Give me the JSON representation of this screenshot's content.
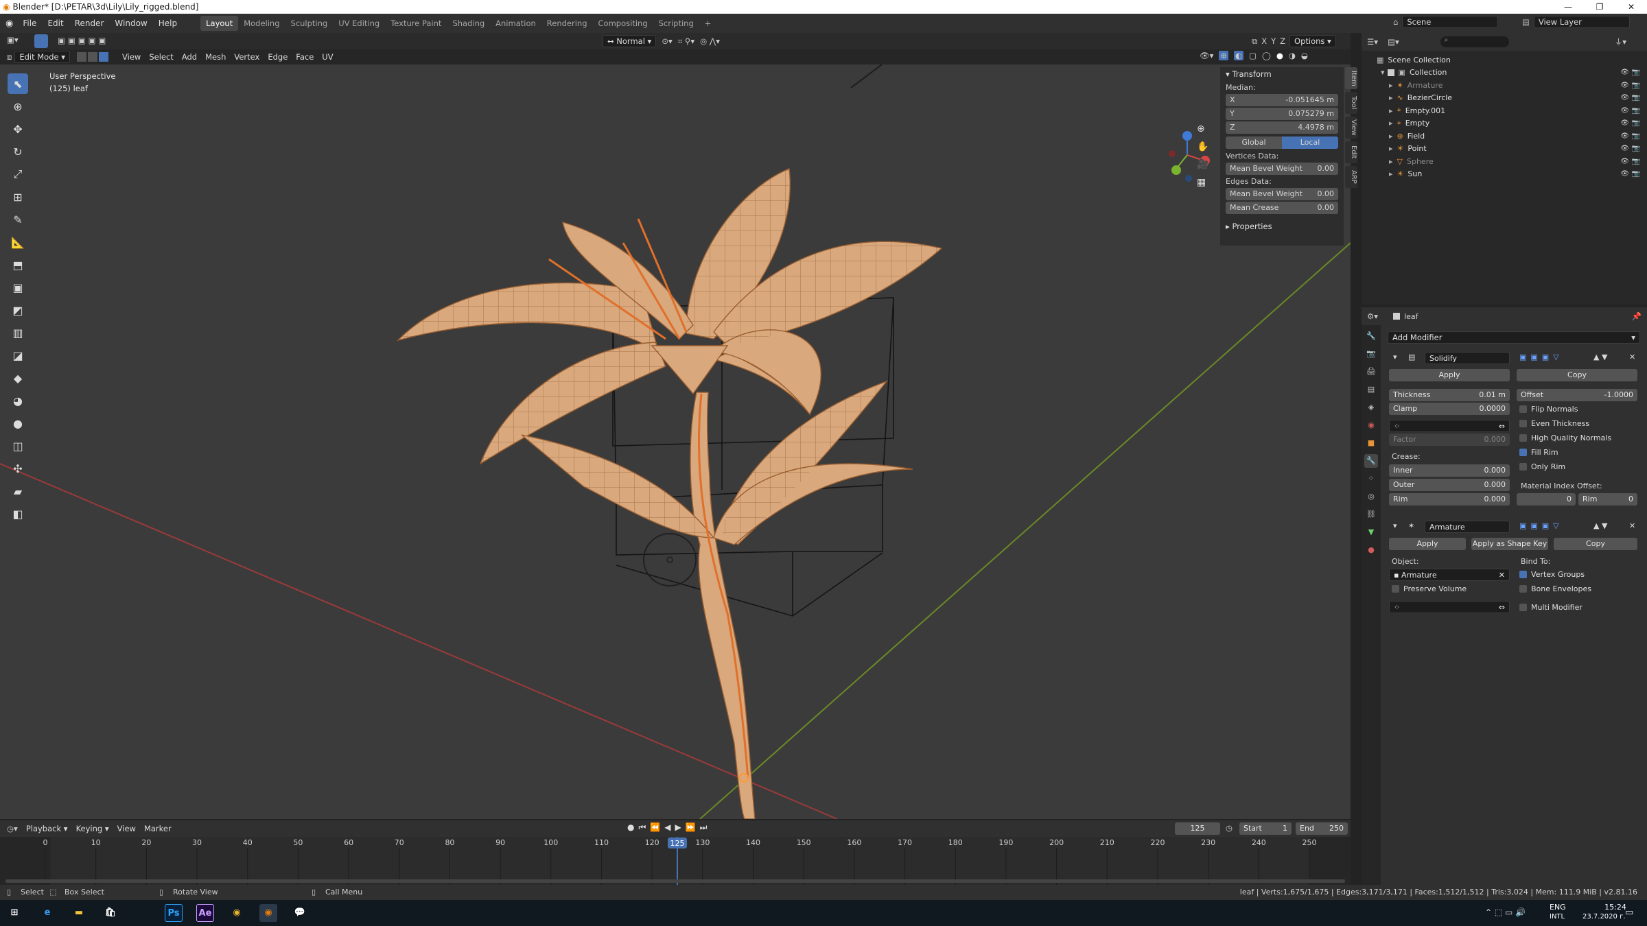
{
  "window": {
    "title": "Blender* [D:\\PETAR\\3d\\Lily\\Lily_rigged.blend]",
    "minimize": "—",
    "maximize": "❐",
    "close": "✕"
  },
  "menu": [
    "File",
    "Edit",
    "Render",
    "Window",
    "Help"
  ],
  "workspaces": [
    "Layout",
    "Modeling",
    "Sculpting",
    "UV Editing",
    "Texture Paint",
    "Shading",
    "Animation",
    "Rendering",
    "Compositing",
    "Scripting"
  ],
  "workspace_add": "+",
  "scene": {
    "label": "Scene",
    "view_layer": "View Layer"
  },
  "viewport_header": {
    "mode": "Edit Mode",
    "menus": [
      "View",
      "Select",
      "Add",
      "Mesh",
      "Vertex",
      "Edge",
      "Face",
      "UV"
    ],
    "orientation": "Normal",
    "options": "Options",
    "axes": [
      "X",
      "Y",
      "Z"
    ]
  },
  "viewport": {
    "perspective": "User Perspective",
    "object_info": "(125) leaf"
  },
  "npanel": {
    "section": "Transform",
    "median_label": "Median:",
    "median": [
      {
        "axis": "X",
        "value": "-0.051645 m"
      },
      {
        "axis": "Y",
        "value": "0.075279 m"
      },
      {
        "axis": "Z",
        "value": "4.4978 m"
      }
    ],
    "global": "Global",
    "local": "Local",
    "vertices_label": "Vertices Data:",
    "vertex_bevel": {
      "label": "Mean Bevel Weight",
      "value": "0.00"
    },
    "edges_label": "Edges Data:",
    "edge_bevel": {
      "label": "Mean Bevel Weight",
      "value": "0.00"
    },
    "edge_crease": {
      "label": "Mean Crease",
      "value": "0.00"
    },
    "properties": "Properties",
    "tabs": [
      "Item",
      "Tool",
      "View",
      "Edit",
      "ARP"
    ]
  },
  "outliner": {
    "root": "Scene Collection",
    "collection": "Collection",
    "items": [
      {
        "name": "Armature",
        "faded": true
      },
      {
        "name": "BezierCircle",
        "faded": false
      },
      {
        "name": "Empty.001",
        "faded": false
      },
      {
        "name": "Empty",
        "faded": false
      },
      {
        "name": "Field",
        "faded": false
      },
      {
        "name": "Point",
        "faded": false
      },
      {
        "name": "Sphere",
        "faded": true
      },
      {
        "name": "Sun",
        "faded": false
      }
    ]
  },
  "properties": {
    "object": "leaf",
    "add_modifier": "Add Modifier",
    "solidify": {
      "name": "Solidify",
      "apply": "Apply",
      "copy": "Copy",
      "thickness": {
        "label": "Thickness",
        "value": "0.01 m"
      },
      "offset": {
        "label": "Offset",
        "value": "-1.0000"
      },
      "clamp": {
        "label": "Clamp",
        "value": "0.0000"
      },
      "factor": {
        "label": "Factor",
        "value": "0.000"
      },
      "flip_normals": "Flip Normals",
      "even_thickness": "Even Thickness",
      "high_quality": "High Quality Normals",
      "fill_rim": "Fill Rim",
      "only_rim": "Only Rim",
      "crease_label": "Crease:",
      "inner": {
        "label": "Inner",
        "value": "0.000"
      },
      "outer": {
        "label": "Outer",
        "value": "0.000"
      },
      "rim": {
        "label": "Rim",
        "value": "0.000"
      },
      "mat_offset_label": "Material Index Offset:",
      "mat_offset": "0",
      "mat_rim": {
        "label": "Rim",
        "value": "0"
      }
    },
    "armature": {
      "name": "Armature",
      "apply": "Apply",
      "apply_shape": "Apply as Shape Key",
      "copy": "Copy",
      "object_label": "Object:",
      "object_value": "Armature",
      "preserve_volume": "Preserve Volume",
      "bind_to": "Bind To:",
      "vertex_groups": "Vertex Groups",
      "bone_envelopes": "Bone Envelopes",
      "multi_modifier": "Multi Modifier"
    }
  },
  "timeline": {
    "menus": [
      "Playback",
      "Keying",
      "View",
      "Marker"
    ],
    "current": "125",
    "start_label": "Start",
    "start": "1",
    "end_label": "End",
    "end": "250",
    "ticks": [
      "0",
      "10",
      "20",
      "30",
      "40",
      "50",
      "60",
      "70",
      "80",
      "90",
      "100",
      "110",
      "120",
      "130",
      "140",
      "150",
      "160",
      "170",
      "180",
      "190",
      "200",
      "210",
      "220",
      "230",
      "240",
      "250"
    ],
    "playhead_frame": 125
  },
  "status": {
    "select": "Select",
    "box_select": "Box Select",
    "rotate": "Rotate View",
    "call_menu": "Call Menu",
    "stats": "leaf | Verts:1,675/1,675 | Edges:3,171/3,171 | Faces:1,512/1,512 | Tris:3,024 | Mem: 111.9 MiB | v2.81.16"
  },
  "taskbar": {
    "lang": "ENG",
    "lang2": "INTL",
    "time": "15:24",
    "date": "23.7.2020 г.",
    "apps": [
      "Ps",
      "Ae"
    ]
  },
  "colors": {
    "accent": "#4772b3",
    "mesh": "#d9a87c",
    "selected_edge": "#ff8a3a"
  }
}
